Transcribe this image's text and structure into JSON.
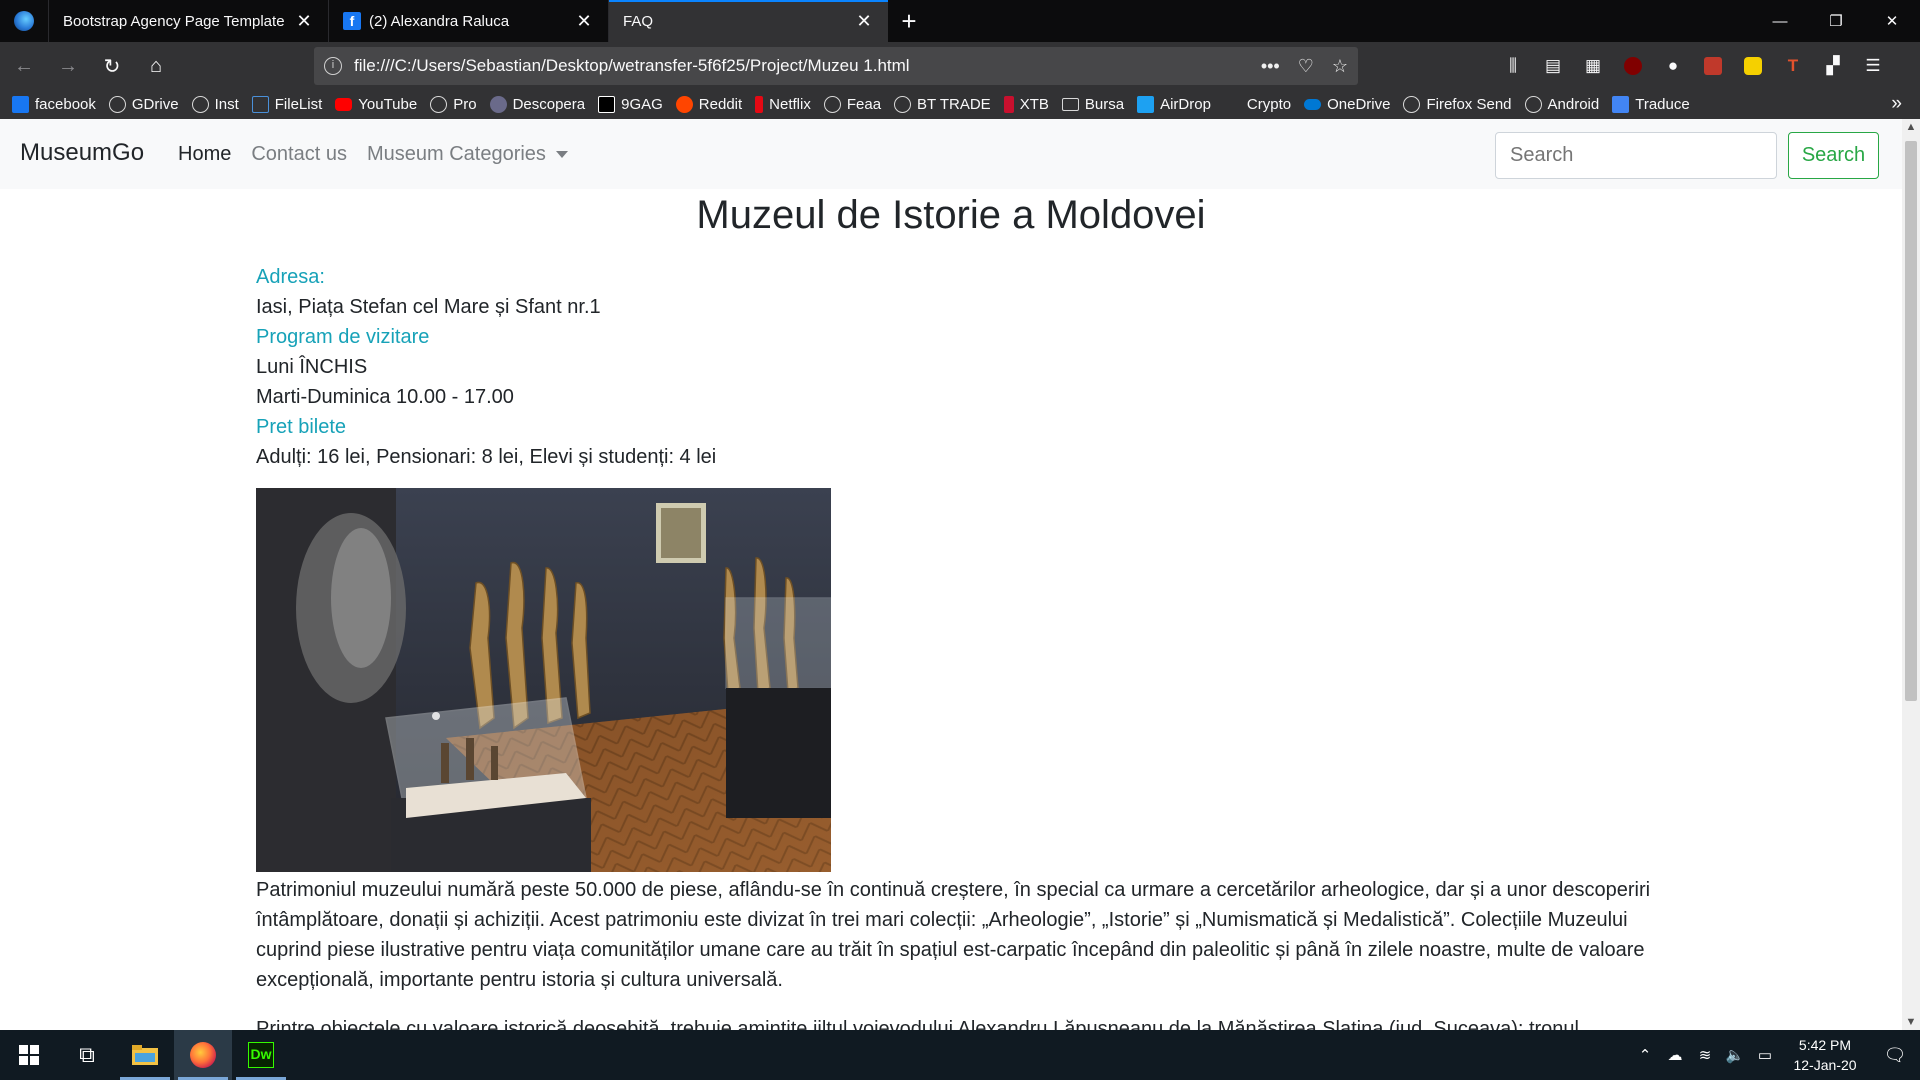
{
  "browser": {
    "tabs": [
      {
        "title": "Bootstrap Agency Page Template",
        "active": false
      },
      {
        "title": "(2) Alexandra Raluca",
        "active": false
      },
      {
        "title": "FAQ",
        "active": true
      }
    ],
    "url": "file:///C:/Users/Sebastian/Desktop/wetransfer-5f6f25/Project/Muzeu 1.html",
    "bookmarks": [
      "facebook",
      "GDrive",
      "Inst",
      "FileList",
      "YouTube",
      "Pro",
      "Descopera",
      "9GAG",
      "Reddit",
      "Netflix",
      "Feaa",
      "BT TRADE",
      "XTB",
      "Bursa",
      "AirDrop",
      "Crypto",
      "OneDrive",
      "Firefox Send",
      "Android",
      "Traduce"
    ]
  },
  "site": {
    "brand": "MuseumGo",
    "nav": {
      "home": "Home",
      "contact": "Contact us",
      "categories": "Museum Categories"
    },
    "search": {
      "placeholder": "Search",
      "button": "Search"
    }
  },
  "museum": {
    "title": "Muzeul de Istorie a Moldovei",
    "address_label": "Adresa:",
    "address": "Iasi, Piața Stefan cel Mare și Sfant nr.1",
    "schedule_label": "Program de vizitare",
    "schedule_monday": "Luni ÎNCHIS",
    "schedule_week": "Marti-Duminica 10.00 - 17.00",
    "price_label": "Pret bilete",
    "prices": "Adulți: 16 lei, Pensionari: 8 lei, Elevi și studenți: 4 lei",
    "paragraph1": "Patrimoniul muzeului numără peste 50.000 de piese, aflându-se în continuă creștere, în special ca urmare a cercetărilor arheologice, dar și a unor descoperiri întâmplătoare, donații și achiziții. Acest patrimoniu este divizat în trei mari colecții: „Arheologie”, „Istorie” și „Numismatică și Medalistică”. Colecțiile Muzeului cuprind piese ilustrative pentru viața comunităților umane care au trăit în spațiul est-carpatic începând din paleolitic și până în zilele noastre, multe de valoare excepțională, importante pentru istoria și cultura universală.",
    "paragraph2": "Printre obiectele cu valoare istorică deosebită, trebuie amintite jiltul voievodului Alexandru Lăpușneanu de la Mănăstirea Slatina (jud. Suceava); tronul"
  },
  "taskbar": {
    "time": "5:42 PM",
    "date": "12-Jan-20"
  },
  "colors": {
    "accent_teal": "#17a2b8",
    "success_green": "#28a745",
    "browser_dark": "#323234"
  }
}
